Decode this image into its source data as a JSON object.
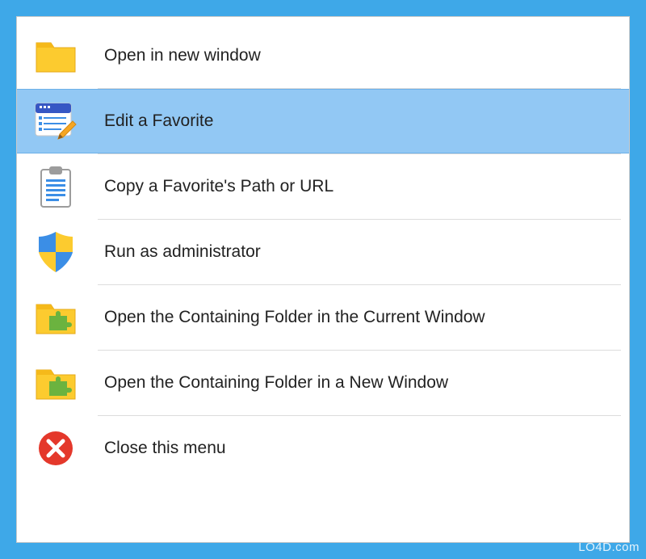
{
  "menu": {
    "items": [
      {
        "icon": "folder-icon",
        "label": "Open in new window",
        "selected": false
      },
      {
        "icon": "edit-favorite-icon",
        "label": "Edit a Favorite",
        "selected": true
      },
      {
        "icon": "clipboard-icon",
        "label": "Copy a Favorite's Path or URL",
        "selected": false
      },
      {
        "icon": "shield-icon",
        "label": "Run as administrator",
        "selected": false
      },
      {
        "icon": "folder-puzzle-icon",
        "label": "Open the Containing Folder in the Current Window",
        "selected": false
      },
      {
        "icon": "folder-puzzle-icon",
        "label": "Open the Containing Folder in a New Window",
        "selected": false
      },
      {
        "icon": "close-icon",
        "label": "Close this menu",
        "selected": false
      }
    ]
  },
  "watermark": "LO4D.com"
}
